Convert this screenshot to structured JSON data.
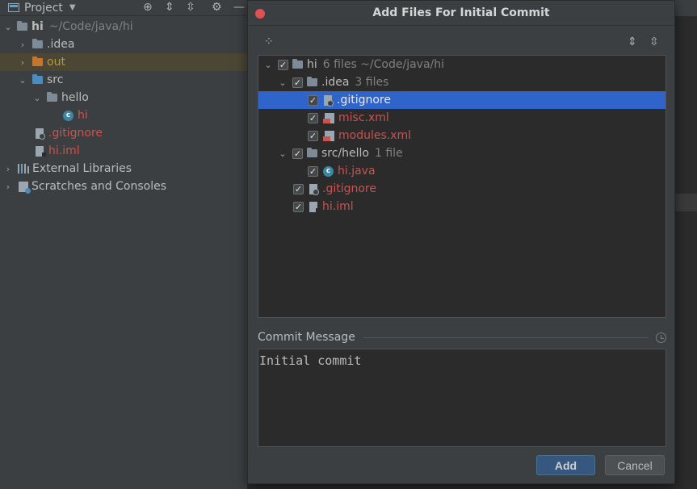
{
  "project_panel": {
    "title": "Project",
    "tree": [
      {
        "label": "hi",
        "hint": "~/Code/java/hi"
      },
      {
        "label": ".idea"
      },
      {
        "label": "out"
      },
      {
        "label": "src"
      },
      {
        "label": "hello"
      },
      {
        "label": "hi"
      },
      {
        "label": ".gitignore"
      },
      {
        "label": "hi.iml"
      },
      {
        "label": "External Libraries"
      },
      {
        "label": "Scratches and Consoles"
      }
    ]
  },
  "dialog": {
    "title": "Add Files For Initial Commit",
    "files": [
      {
        "label": "hi",
        "count": "6 files  ~/Code/java/hi"
      },
      {
        "label": ".idea",
        "count": "3 files"
      },
      {
        "label": ".gitignore"
      },
      {
        "label": "misc.xml"
      },
      {
        "label": "modules.xml"
      },
      {
        "label": "src/hello",
        "count": "1 file"
      },
      {
        "label": "hi.java"
      },
      {
        "label": ".gitignore"
      },
      {
        "label": "hi.iml"
      }
    ],
    "commit_label": "Commit Message",
    "commit_message": "Initial commit",
    "add_label": "Add",
    "cancel_label": "Cancel"
  }
}
